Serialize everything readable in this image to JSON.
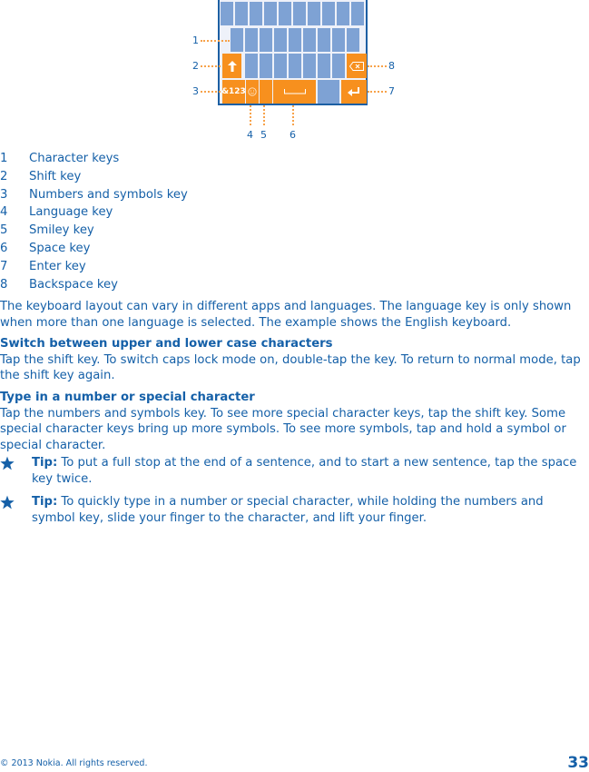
{
  "diagram": {
    "callouts_left": [
      "1",
      "2",
      "3"
    ],
    "callouts_right": [
      "8",
      "7"
    ],
    "callouts_bottom": [
      "4",
      "5",
      "6"
    ],
    "numbers_key_label": "&123",
    "colors": {
      "key_blue": "#7ea2d4",
      "key_orange": "#f7901e",
      "frame": "#1c5fa3",
      "callout_dots": "#f7a24a"
    }
  },
  "legend": [
    {
      "num": "1",
      "label": "Character keys"
    },
    {
      "num": "2",
      "label": "Shift key"
    },
    {
      "num": "3",
      "label": "Numbers and symbols key"
    },
    {
      "num": "4",
      "label": "Language key"
    },
    {
      "num": "5",
      "label": "Smiley key"
    },
    {
      "num": "6",
      "label": "Space key"
    },
    {
      "num": "7",
      "label": "Enter key"
    },
    {
      "num": "8",
      "label": "Backspace key"
    }
  ],
  "intro": "The keyboard layout can vary in different apps and languages. The language key is only shown when more than one language is selected. The example shows the English keyboard.",
  "sections": [
    {
      "heading": "Switch between upper and lower case characters",
      "body": "Tap the shift key. To switch caps lock mode on, double-tap the key. To return to normal mode, tap the shift key again."
    },
    {
      "heading": "Type in a number or special character",
      "body": "Tap the numbers and symbols key. To see more special character keys, tap the shift key. Some special character keys bring up more symbols. To see more symbols, tap and hold a symbol or special character."
    }
  ],
  "tips": [
    {
      "label": "Tip:",
      "text": " To put a full stop at the end of a sentence, and to start a new sentence, tap the space key twice."
    },
    {
      "label": "Tip:",
      "text": " To quickly type in a number or special character, while holding the numbers and symbol key, slide your finger to the character, and lift your finger."
    }
  ],
  "footer": {
    "copyright": "© 2013 Nokia. All rights reserved.",
    "page_number": "33"
  }
}
